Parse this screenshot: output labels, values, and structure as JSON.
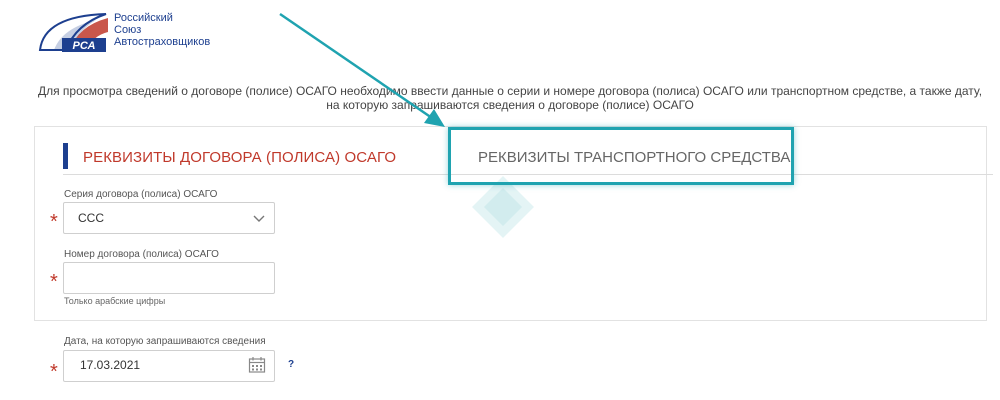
{
  "logo": {
    "line1": "Российский",
    "line2": "Союз",
    "line3": "Автостраховщиков",
    "mark_text": "РСА"
  },
  "intro_text": "Для просмотра сведений о договоре (полисе) ОСАГО необходимо ввести данные о серии и номере договора (полиса) ОСАГО или транспортном средстве, а также дату, на которую запрашиваются сведения о договоре (полисе) ОСАГО",
  "tabs": {
    "active_label": "РЕКВИЗИТЫ ДОГОВОРА (ПОЛИСА) ОСАГО",
    "inactive_label": "РЕКВИЗИТЫ ТРАНСПОРТНОГО СРЕДСТВА"
  },
  "form": {
    "series_label": "Серия договора (полиса) ОСАГО",
    "series_value": "ССС",
    "number_label": "Номер договора (полиса) ОСАГО",
    "number_value": "",
    "number_hint": "Только арабские цифры",
    "date_label": "Дата, на которую запрашиваются сведения",
    "date_value": "17.03.2021",
    "required_mark": "*",
    "help_mark": "?"
  },
  "colors": {
    "brand_blue": "#1d3f8f",
    "brand_red": "#c0392b",
    "annotation_teal": "#1fa3b0"
  },
  "icons": [
    "rsa-logo",
    "chevron-down-icon",
    "calendar-icon",
    "help-icon",
    "arrow-annotation"
  ]
}
